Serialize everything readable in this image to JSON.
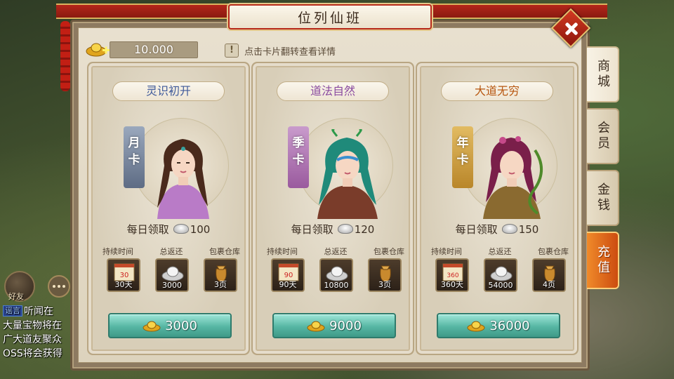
{
  "window": {
    "title": "位列仙班"
  },
  "currency": {
    "gold_amount": "10.000"
  },
  "hint": {
    "text": "点击卡片翻转查看详情"
  },
  "cards": [
    {
      "title": "灵识初开",
      "title_color": "#3f5a9a",
      "banner_text": "月卡",
      "banner_color": "#7f8fa6",
      "daily_label": "每日领取",
      "daily_amount": "100",
      "stat_labels": [
        "持续时间",
        "总返还",
        "包裹仓库"
      ],
      "stat_values": [
        "30天",
        "3000",
        "3页"
      ],
      "calendar_number": "30",
      "price": "3000"
    },
    {
      "title": "道法自然",
      "title_color": "#8a4aa0",
      "banner_text": "季卡",
      "banner_color": "#b685b8",
      "daily_label": "每日领取",
      "daily_amount": "120",
      "stat_labels": [
        "持续时间",
        "总返还",
        "包裹仓库"
      ],
      "stat_values": [
        "90天",
        "10800",
        "3页"
      ],
      "calendar_number": "90",
      "price": "9000"
    },
    {
      "title": "大道无穷",
      "title_color": "#b7560f",
      "banner_text": "年卡",
      "banner_color": "#d3a64d",
      "daily_label": "每日领取",
      "daily_amount": "150",
      "stat_labels": [
        "持续时间",
        "总返还",
        "包裹仓库"
      ],
      "stat_values": [
        "360天",
        "54000",
        "4页"
      ],
      "calendar_number": "360",
      "price": "36000"
    }
  ],
  "tabs": [
    {
      "label": "商城"
    },
    {
      "label": "会员"
    },
    {
      "label": "金钱"
    },
    {
      "label": "充值"
    }
  ],
  "chat": {
    "friend_label": "好友",
    "tag": "谣言",
    "lines": [
      "听闻在",
      "大量宝物将在",
      "广大道友聚众",
      "OSS将会获得"
    ]
  }
}
